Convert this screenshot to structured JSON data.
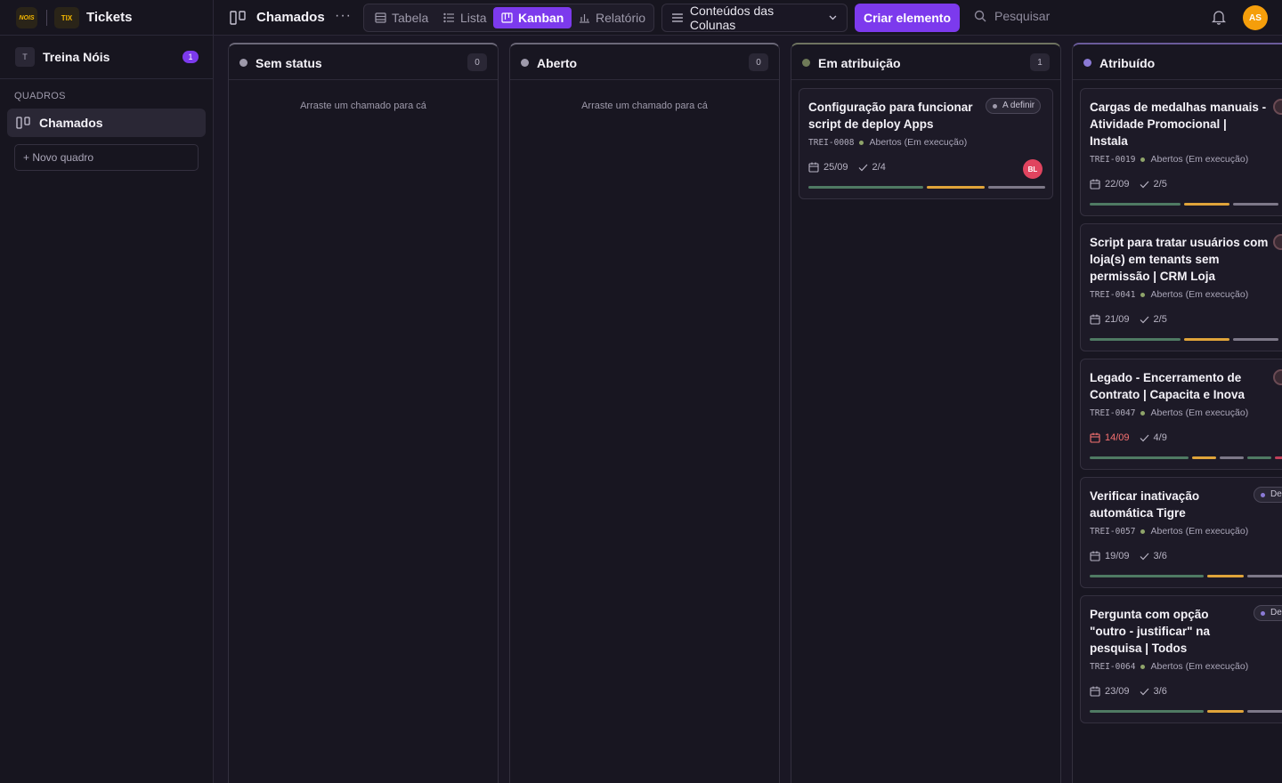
{
  "brand": {
    "logo_text": "NOIS",
    "app_logo_text": "TIX",
    "title": "Tickets"
  },
  "header": {
    "board_title": "Chamados",
    "more": "···",
    "views": [
      {
        "label": "Tabela",
        "icon": "table-icon"
      },
      {
        "label": "Lista",
        "icon": "list-icon"
      },
      {
        "label": "Kanban",
        "icon": "kanban-icon",
        "active": true
      },
      {
        "label": "Relatório",
        "icon": "chart-icon"
      }
    ],
    "columns_menu_label": "Conteúdos das Colunas",
    "create_label": "Criar elemento",
    "search_placeholder": "Pesquisar",
    "avatar_initials": "AS"
  },
  "sidebar": {
    "workspace_initial": "T",
    "workspace_name": "Treina Nóis",
    "workspace_count": "1",
    "section_label": "QUADROS",
    "active_item": "Chamados",
    "new_board_label": "+ Novo quadro"
  },
  "colors": {
    "accent": "#7c3aed",
    "sem_status": "#9e9aab",
    "aberto": "#9e9aab",
    "em_atribuicao": "#6f7a58",
    "atribuido": "#8b7ad6",
    "bar_green": "#4f7a63",
    "bar_orange": "#e0a43a",
    "bar_gray": "#7d7888",
    "overdue": "#f87171"
  },
  "columns": [
    {
      "title": "Sem status",
      "count": "0",
      "empty_hint": "Arraste um chamado para cá"
    },
    {
      "title": "Aberto",
      "count": "0",
      "empty_hint": "Arraste um chamado para cá"
    },
    {
      "title": "Em atribuição",
      "count": "1",
      "cards": [
        {
          "title_lines": [
            "Configuração para funcionar",
            "script de deploy Apps"
          ],
          "pill": "A definir",
          "id": "TREI-0008",
          "status": "Abertos (Em execução)",
          "date": "25/09",
          "checklist": "2/4",
          "assignee": "BL"
        }
      ]
    },
    {
      "title": "Atribuído",
      "count": "",
      "cards": [
        {
          "title_lines": [
            "Cargas de medalhas manuais -",
            "Atividade Promocional |",
            "Instala"
          ],
          "id": "TREI-0019",
          "status": "Abertos (Em execução)",
          "date": "22/09",
          "checklist": "2/5"
        },
        {
          "title_lines": [
            "Script para tratar usuários com",
            "loja(s) em tenants sem",
            "permissão | CRM Loja"
          ],
          "id": "TREI-0041",
          "status": "Abertos (Em execução)",
          "date": "21/09",
          "checklist": "2/5"
        },
        {
          "title_lines": [
            "Legado - Encerramento de",
            "Contrato | Capacita e Inova"
          ],
          "id": "TREI-0047",
          "status": "Abertos (Em execução)",
          "date": "14/09",
          "checklist": "4/9",
          "overdue": true
        },
        {
          "title_lines": [
            "Verificar inativação",
            "automática Tigre"
          ],
          "pill": "De",
          "id": "TREI-0057",
          "status": "Abertos (Em execução)",
          "date": "19/09",
          "checklist": "3/6"
        },
        {
          "title_lines": [
            "Pergunta com opção",
            "\"outro - justificar\" na",
            "pesquisa | Todos"
          ],
          "pill": "De",
          "id": "TREI-0064",
          "status": "Abertos (Em execução)",
          "date": "23/09",
          "checklist": "3/6"
        }
      ]
    }
  ]
}
